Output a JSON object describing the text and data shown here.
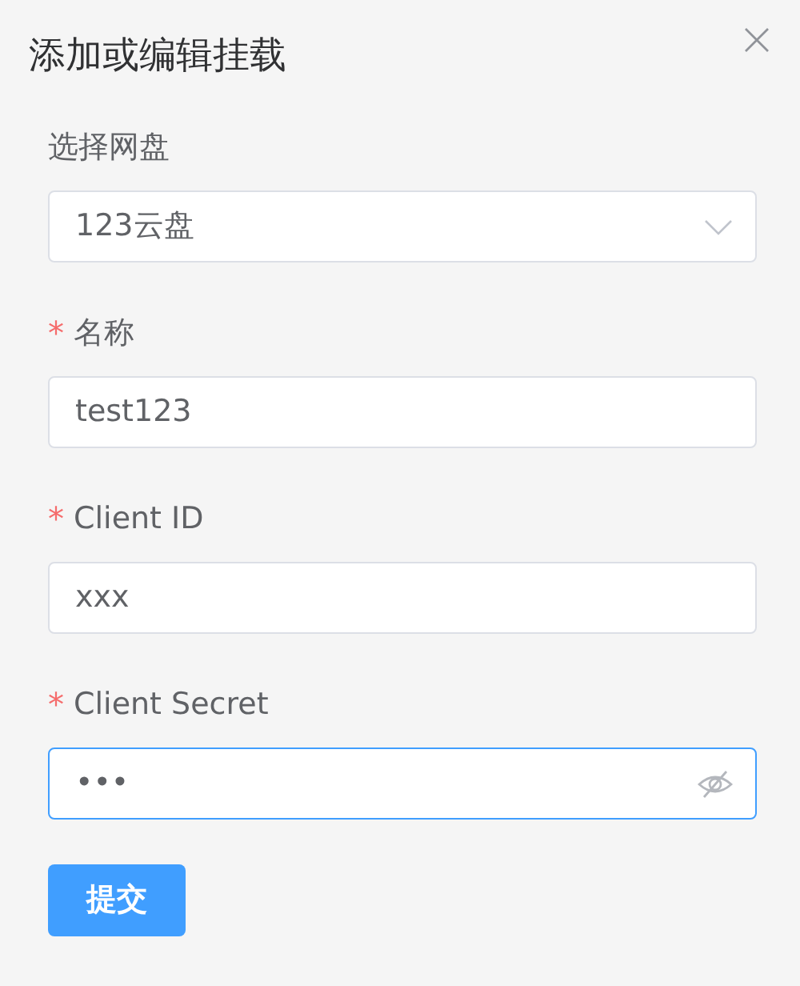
{
  "dialog": {
    "title": "添加或编辑挂载"
  },
  "fields": [
    {
      "kind": "select",
      "label": "选择网盘",
      "value": "123云盘",
      "focused": false
    },
    {
      "kind": "text",
      "required_mark": "*",
      "label": "名称",
      "value": "test123",
      "focused": false
    },
    {
      "kind": "text",
      "required_mark": "*",
      "label": "Client ID",
      "value": "xxx",
      "focused": false
    },
    {
      "kind": "password",
      "required_mark": "*",
      "label": "Client Secret",
      "value": "•••",
      "focused": true
    }
  ],
  "submit_button": "提交"
}
